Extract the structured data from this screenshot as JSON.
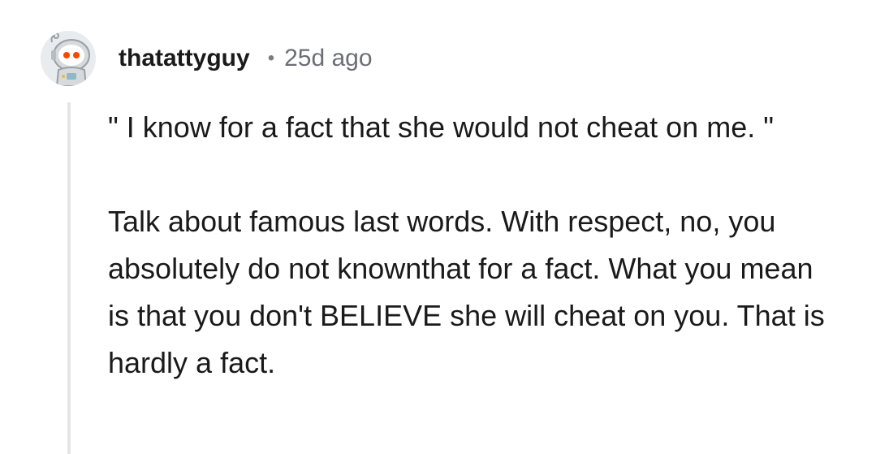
{
  "comment": {
    "username": "thatattyguy",
    "separator": "•",
    "timestamp": "25d ago",
    "avatar_icon": "snoo-astronaut-avatar-icon",
    "paragraphs": [
      "\" I know for a fact that she would not cheat on me. \"",
      "Talk about famous last words. With respect, no, you absolutely do not knownthat for a fact. What you mean is that you don't BELIEVE she will cheat on you. That is hardly a fact."
    ]
  },
  "colors": {
    "accent_orange": "#ff4500",
    "thread_line": "#e3e5e8",
    "text": "#1a1a1b",
    "meta_text": "#6b6f73"
  }
}
